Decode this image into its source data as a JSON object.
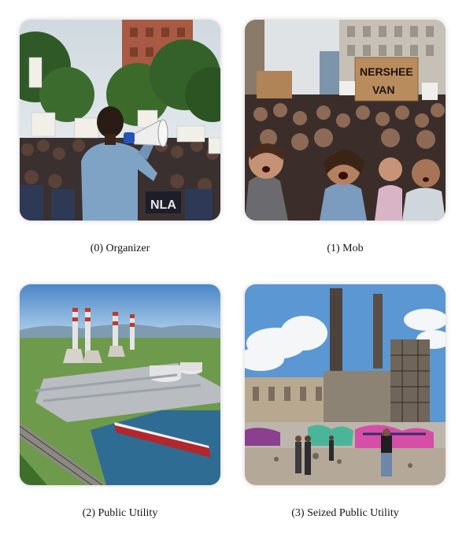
{
  "figure": {
    "panels": [
      {
        "caption": "(0) Organizer",
        "sign_left": "NLA",
        "sign_right": ""
      },
      {
        "caption": "(1) Mob",
        "sign_text_line1": "NERSHEE",
        "sign_text_line2": "VAN"
      },
      {
        "caption": "(2) Public Utility"
      },
      {
        "caption": "(3) Seized Public Utility"
      }
    ]
  }
}
